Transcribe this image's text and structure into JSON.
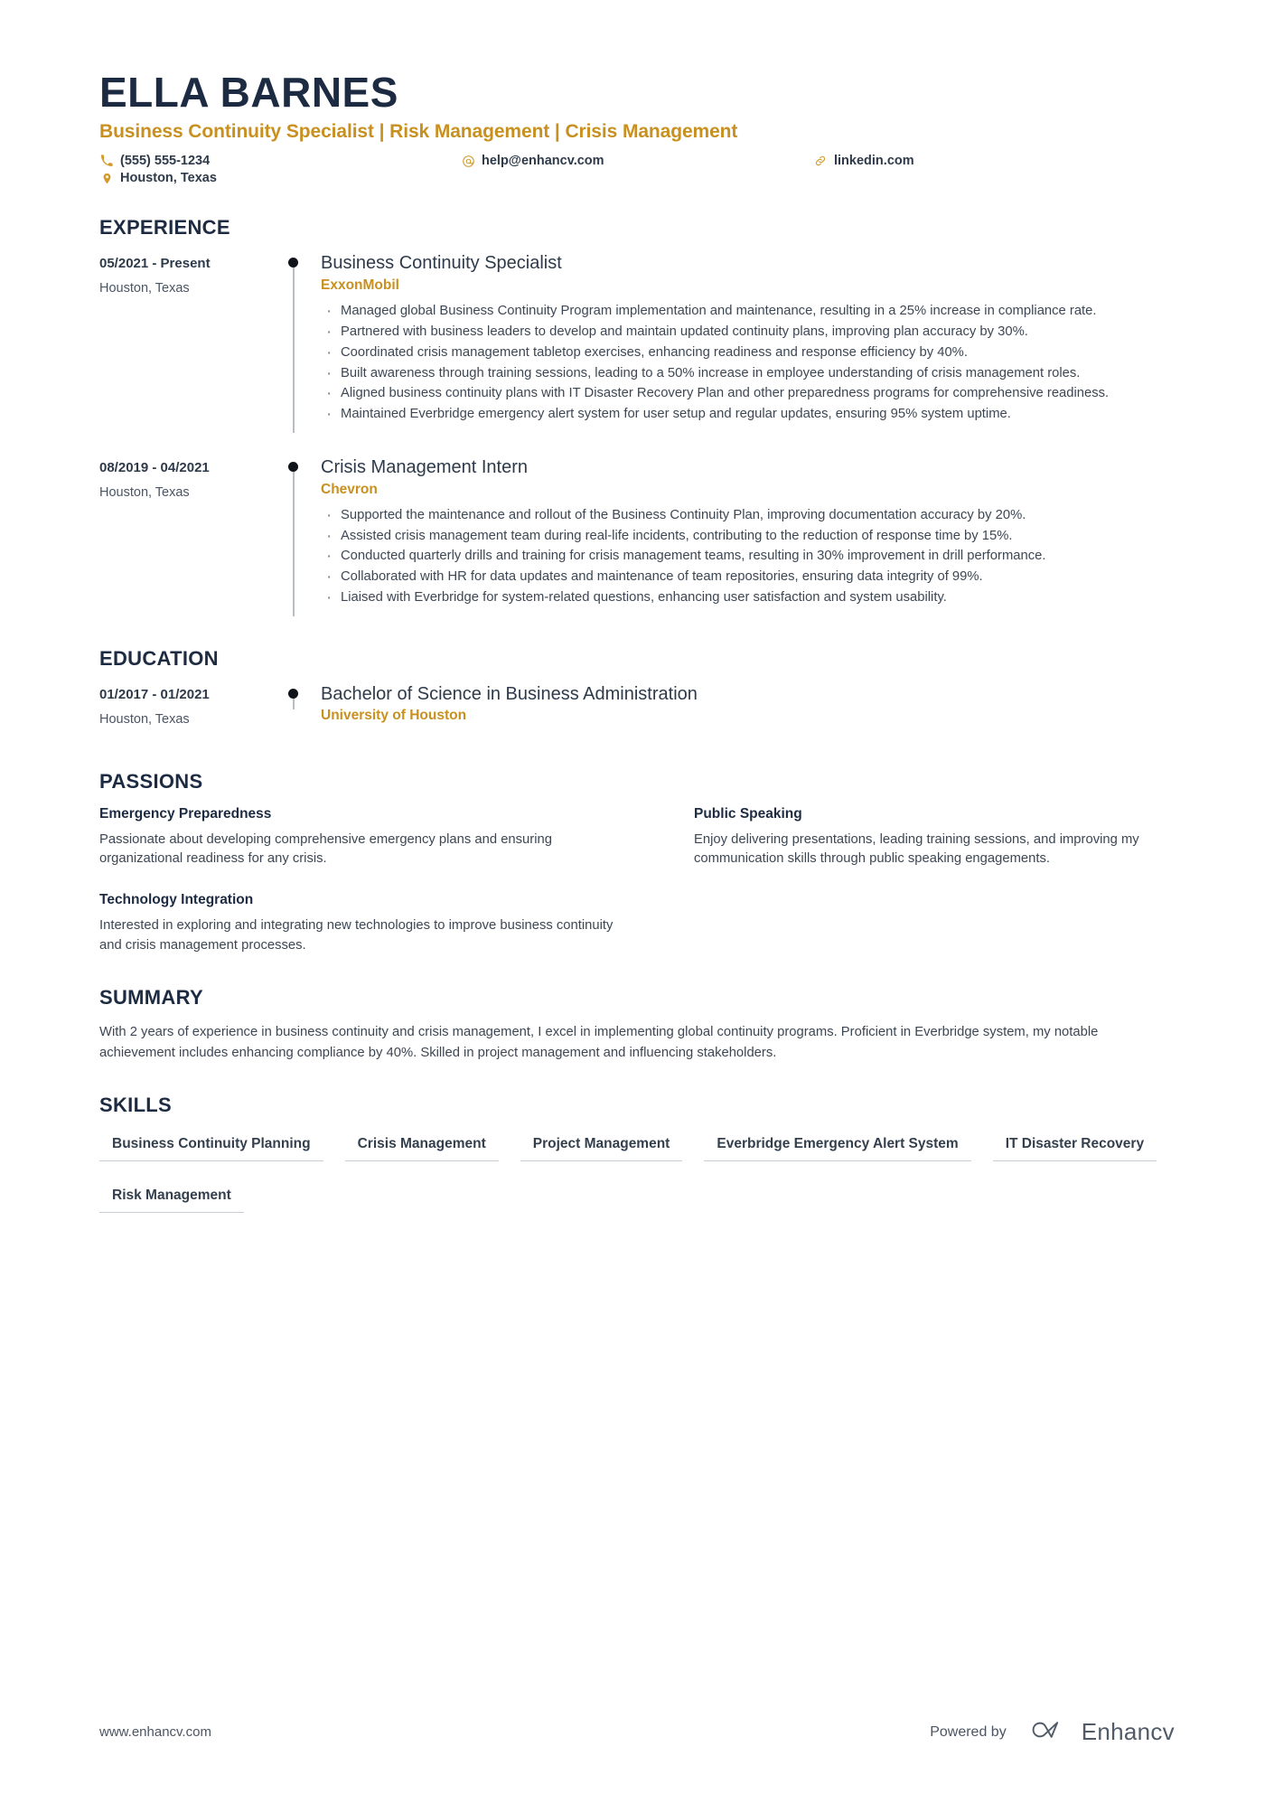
{
  "header": {
    "name": "ELLA BARNES",
    "headline": "Business Continuity Specialist | Risk Management | Crisis Management",
    "contacts": [
      {
        "icon": "phone-icon",
        "text": "(555) 555-1234"
      },
      {
        "icon": "email-icon",
        "text": "help@enhancv.com"
      },
      {
        "icon": "link-icon",
        "text": "linkedin.com"
      },
      {
        "icon": "location-pin-icon",
        "text": "Houston, Texas"
      }
    ]
  },
  "colors": {
    "accent_gold": "#C8901F",
    "heading_navy": "#1D2B42",
    "body_gray": "#3D4754",
    "rail_gray": "#B9BEC6"
  },
  "sections": {
    "experience": {
      "title": "EXPERIENCE",
      "entries": [
        {
          "date": "05/2021 - Present",
          "location": "Houston, Texas",
          "role": "Business Continuity Specialist",
          "organization": "ExxonMobil",
          "bullets": [
            "Managed global Business Continuity Program implementation and maintenance, resulting in a 25% increase in compliance rate.",
            "Partnered with business leaders to develop and maintain updated continuity plans, improving plan accuracy by 30%.",
            "Coordinated crisis management tabletop exercises, enhancing readiness and response efficiency by 40%.",
            "Built awareness through training sessions, leading to a 50% increase in employee understanding of crisis management roles.",
            "Aligned business continuity plans with IT Disaster Recovery Plan and other preparedness programs for comprehensive readiness.",
            "Maintained Everbridge emergency alert system for user setup and regular updates, ensuring 95% system uptime."
          ]
        },
        {
          "date": "08/2019 - 04/2021",
          "location": "Houston, Texas",
          "role": "Crisis Management Intern",
          "organization": "Chevron",
          "bullets": [
            "Supported the maintenance and rollout of the Business Continuity Plan, improving documentation accuracy by 20%.",
            "Assisted crisis management team during real-life incidents, contributing to the reduction of response time by 15%.",
            "Conducted quarterly drills and training for crisis management teams, resulting in 30% improvement in drill performance.",
            "Collaborated with HR for data updates and maintenance of team repositories, ensuring data integrity of 99%.",
            "Liaised with Everbridge for system-related questions, enhancing user satisfaction and system usability."
          ]
        }
      ]
    },
    "education": {
      "title": "EDUCATION",
      "entries": [
        {
          "date": "01/2017 - 01/2021",
          "location": "Houston, Texas",
          "degree": "Bachelor of Science in Business Administration",
          "institution": "University of Houston"
        }
      ]
    },
    "passions": {
      "title": "PASSIONS",
      "items": [
        {
          "title": "Emergency Preparedness",
          "text": "Passionate about developing comprehensive emergency plans and ensuring organizational readiness for any crisis."
        },
        {
          "title": "Public Speaking",
          "text": "Enjoy delivering presentations, leading training sessions, and improving my communication skills through public speaking engagements."
        },
        {
          "title": "Technology Integration",
          "text": "Interested in exploring and integrating new technologies to improve business continuity and crisis management processes."
        }
      ]
    },
    "summary": {
      "title": "SUMMARY",
      "text": "With 2 years of experience in business continuity and crisis management, I excel in implementing global continuity programs. Proficient in Everbridge system, my notable achievement includes enhancing compliance by 40%. Skilled in project management and influencing stakeholders."
    },
    "skills": {
      "title": "SKILLS",
      "items": [
        "Business Continuity Planning",
        "Crisis Management",
        "Project Management",
        "Everbridge Emergency Alert System",
        "IT Disaster Recovery",
        "Risk Management"
      ]
    }
  },
  "footer": {
    "url": "www.enhancv.com",
    "powered_by": "Powered by",
    "brand": "Enhancv"
  }
}
